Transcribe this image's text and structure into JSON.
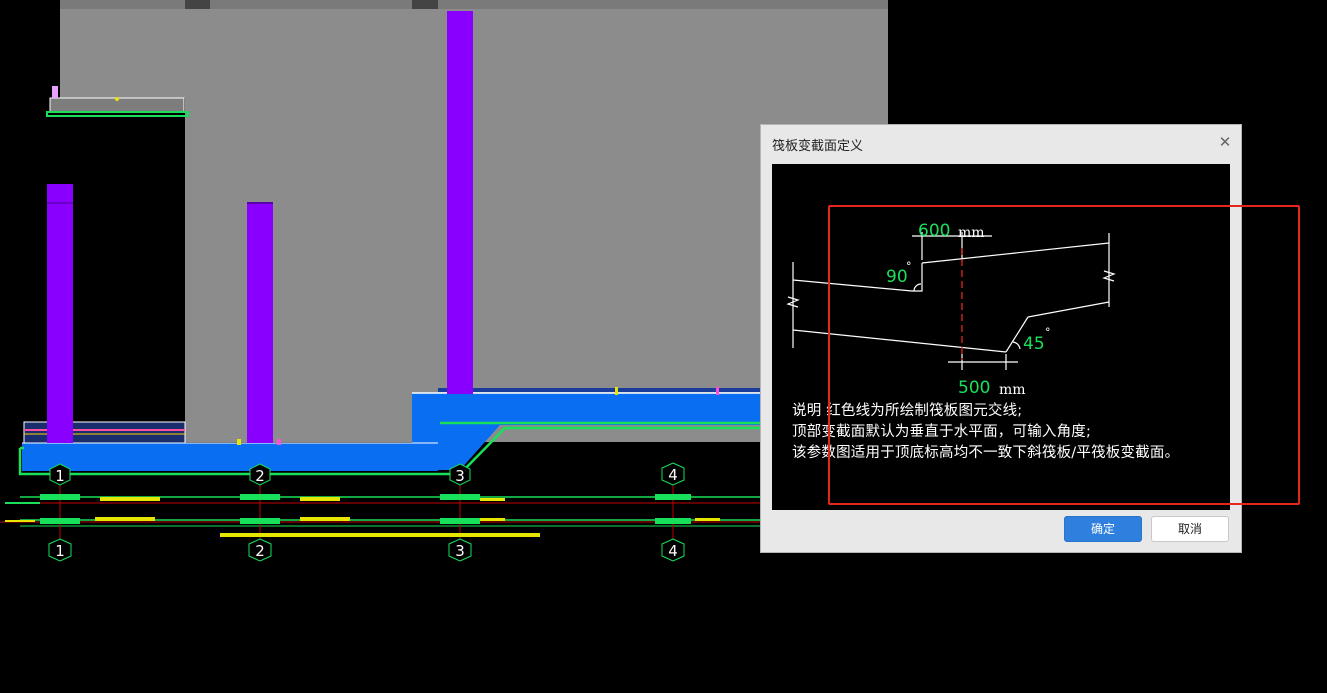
{
  "axis_labels": [
    "1",
    "2",
    "3",
    "4"
  ],
  "dialog": {
    "title": "筏板变截面定义",
    "close_icon": "close-icon",
    "diagram": {
      "top_width": "600",
      "top_unit": "mm",
      "top_angle": "90",
      "bottom_angle": "45",
      "bottom_width": "500",
      "bottom_unit": "mm"
    },
    "notes": [
      "说明  红色线为所绘制筏板图元交线;",
      "顶部变截面默认为垂直于水平面，可输入角度;",
      "该参数图适用于顶底标高均不一致下斜筏板/平筏板变截面。"
    ],
    "ok_label": "确定",
    "cancel_label": "取消"
  },
  "colors": {
    "wall": "#8c8c8c",
    "slab": "#0a6ef2",
    "column": "#8a00ff",
    "outline_green": "#19e05a",
    "dimension_text": "#19e05a",
    "accent_button": "#2f7fde",
    "highlight": "#e3271e"
  }
}
